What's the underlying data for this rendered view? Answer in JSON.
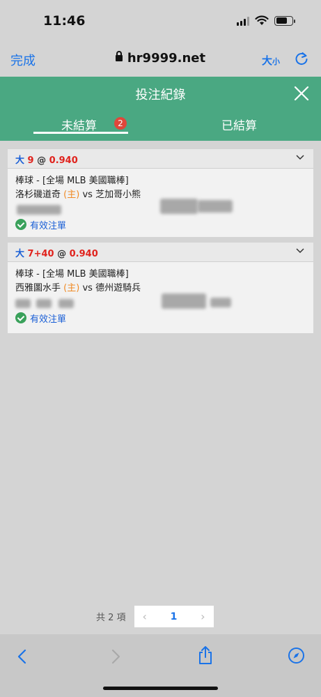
{
  "status": {
    "time": "11:46"
  },
  "browser": {
    "done_label": "完成",
    "url": "hr9999.net",
    "text_size_big": "大",
    "text_size_small": "小"
  },
  "page": {
    "title": "投注紀錄"
  },
  "tabs": [
    {
      "label": "未結算",
      "badge": "2",
      "active": true
    },
    {
      "label": "已結算",
      "active": false
    }
  ],
  "bets": [
    {
      "bet_type": "大",
      "line": "9",
      "at": "@",
      "odds": "0.940",
      "league": "棒球 - [全場 MLB 美國職棒]",
      "home_team": "洛杉磯道奇",
      "home_tag": "(主)",
      "vs": "vs",
      "away_team": "芝加哥小熊",
      "status": "有效注單"
    },
    {
      "bet_type": "大",
      "line": "7+40",
      "at": "@",
      "odds": "0.940",
      "league": "棒球 - [全場 MLB 美國職棒]",
      "home_team": "西雅圖水手",
      "home_tag": "(主)",
      "vs": "vs",
      "away_team": "德州遊騎兵",
      "status": "有效注單"
    }
  ],
  "pager": {
    "total": "共 2 項",
    "prev": "‹",
    "page": "1",
    "next": "›"
  },
  "colors": {
    "accent_green": "#4aa882",
    "link_blue": "#1a73e8",
    "odds_red": "#e0231d",
    "home_orange": "#f08a24",
    "badge_red": "#e0473b"
  }
}
